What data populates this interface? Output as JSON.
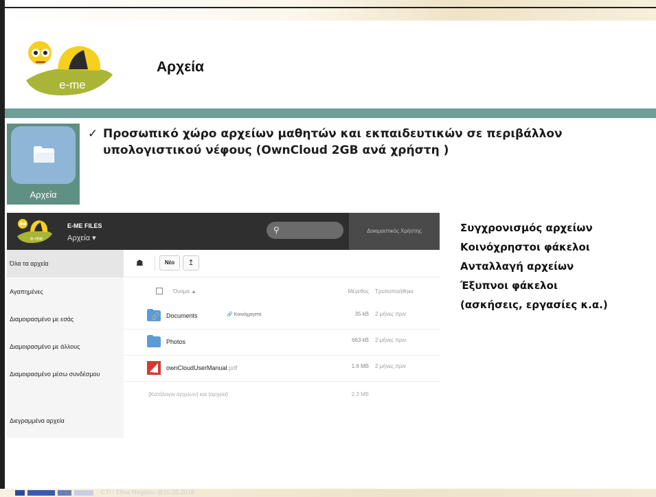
{
  "slide": {
    "title": "Αρχεία",
    "logo_text": "e-me",
    "app_tile_label": "Αρχεία",
    "bullet_check": "✓",
    "bullet_line1": "Προσωπικό χώρο αρχείων μαθητών και εκπαιδευτικών σε περιβάλλον",
    "bullet_line2": "υπολογιστικού νέφους (OwnCloud 2GB ανά χρήστη )",
    "features": [
      "Συγχρονισμός αρχείων",
      "Κοινόχρηστοι φάκελοι",
      "Ανταλλαγή αρχείων",
      "Έξυπνοι φάκελοι",
      "(ασκήσεις, εργασίες κ.α.)"
    ],
    "footer": "CTI / Elina Megalou @15.05.2018",
    "colors": {
      "teal": "#6f9e99",
      "tile": "#8fb6d6",
      "header": "#2f2f2f"
    }
  },
  "files_app": {
    "brand": "E-ME FILES",
    "app_name": "Αρχεία ▾",
    "logo_text": "e-me",
    "search_icon": "search-icon",
    "user": "Δοκιμαστικός Χρήστης",
    "sidebar": [
      "Όλα τα αρχεία",
      "Αγαπημένες",
      "Διαμοιρασμένο με εσάς",
      "Διαμοιρασμένο με άλλους",
      "Διαμοιρασμένο μέσω συνδέσμου",
      "Διεγραμμένα αρχεία"
    ],
    "new_button": "Νέο",
    "columns": {
      "name": "Όνομα ▲",
      "size": "Μέγεθος",
      "modified": "Τροποποιήθηκε"
    },
    "files": [
      {
        "name": "Documents",
        "ext": "",
        "size": "35 kB",
        "modified": "2 μήνες πριν",
        "shared": "Κοινόχρηστα",
        "icon": "shared-folder-icon"
      },
      {
        "name": "Photos",
        "ext": "",
        "size": "663 kB",
        "modified": "2 μήνες πριν",
        "shared": "",
        "icon": "folder-icon"
      },
      {
        "name": "ownCloudUserManual",
        "ext": ".pdf",
        "size": "1.6 MB",
        "modified": "2 μήνες πριν",
        "shared": "",
        "icon": "pdf-icon"
      }
    ],
    "summary": "{Κατάλογοι αρχείων} και {αρχεία}",
    "summary_size": "2.3 MB"
  }
}
